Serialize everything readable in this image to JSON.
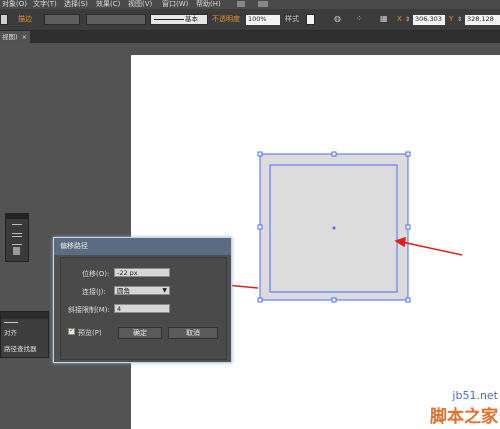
{
  "menu": [
    "对象(O)",
    "文字(T)",
    "选择(S)",
    "效果(C)",
    "视图(V)",
    "窗口(W)",
    "帮助(H)"
  ],
  "toolbar": {
    "stroke_label": "描边",
    "brush_label": "基本",
    "opacity_label": "不透明度",
    "opacity_value": "100%",
    "style_label": "样式",
    "x_label": "X",
    "x_value": "306.303",
    "y_label": "Y",
    "y_value": "328.128"
  },
  "document_tab": {
    "label": "视图)",
    "close": "×"
  },
  "layers_panel": {
    "align_label": "对齐",
    "pathfinder_label": "路径查找器"
  },
  "dialog": {
    "title": "偏移路径",
    "offset_label": "位移(O):",
    "offset_value": "-22 px",
    "joins_label": "连接(J):",
    "joins_value": "圆角",
    "miter_label": "斜接限制(M):",
    "miter_value": "4",
    "preview_label": "预览(P)",
    "ok_label": "确定",
    "cancel_label": "取消"
  },
  "watermark": {
    "site": "jb51.net",
    "brand": "脚本之家"
  },
  "colors": {
    "accent_orange": "#e8912e",
    "selection_blue": "#4a6cff",
    "arrow_red": "#e02020",
    "shape_fill": "#dcdcdc"
  }
}
